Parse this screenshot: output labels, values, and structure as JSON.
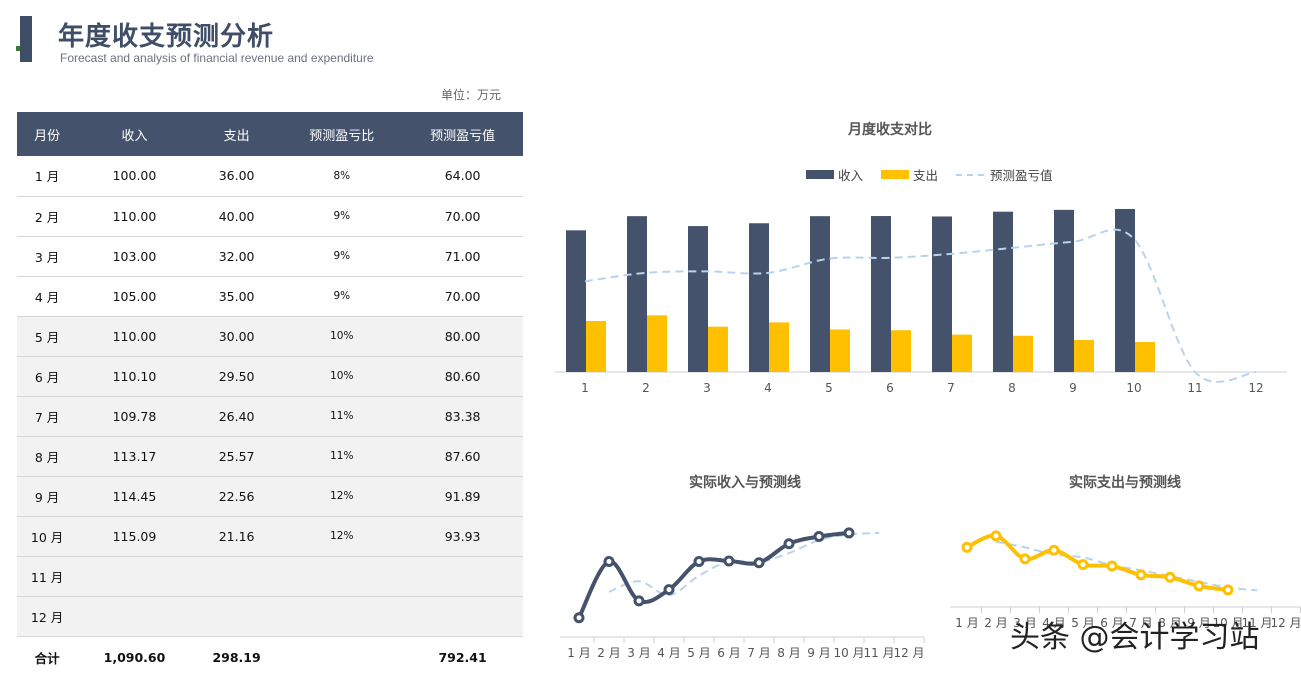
{
  "header": {
    "title": "年度收支预测分析",
    "subtitle": "Forecast and analysis of financial revenue and expenditure",
    "unit": "单位：万元"
  },
  "table": {
    "columns": [
      "月份",
      "收入",
      "支出",
      "预测盈亏比",
      "预测盈亏值"
    ],
    "rows": [
      [
        "1 月",
        "100.00",
        "36.00",
        "8%",
        "64.00"
      ],
      [
        "2 月",
        "110.00",
        "40.00",
        "9%",
        "70.00"
      ],
      [
        "3 月",
        "103.00",
        "32.00",
        "9%",
        "71.00"
      ],
      [
        "4 月",
        "105.00",
        "35.00",
        "9%",
        "70.00"
      ],
      [
        "5 月",
        "110.00",
        "30.00",
        "10%",
        "80.00"
      ],
      [
        "6 月",
        "110.10",
        "29.50",
        "10%",
        "80.60"
      ],
      [
        "7 月",
        "109.78",
        "26.40",
        "11%",
        "83.38"
      ],
      [
        "8 月",
        "113.17",
        "25.57",
        "11%",
        "87.60"
      ],
      [
        "9 月",
        "114.45",
        "22.56",
        "12%",
        "91.89"
      ],
      [
        "10 月",
        "115.09",
        "21.16",
        "12%",
        "93.93"
      ],
      [
        "11 月",
        "",
        "",
        "",
        ""
      ],
      [
        "12 月",
        "",
        "",
        "",
        ""
      ]
    ],
    "total": [
      "合计",
      "1,090.60",
      "298.19",
      "",
      "792.41"
    ]
  },
  "colors": {
    "income": "#44526b",
    "expense": "#ffc000",
    "forecast": "#b9d3ec"
  },
  "chart_data": [
    {
      "type": "bar",
      "title": "月度收支对比",
      "categories": [
        "1",
        "2",
        "3",
        "4",
        "5",
        "6",
        "7",
        "8",
        "9",
        "10",
        "11",
        "12"
      ],
      "series": [
        {
          "name": "收入",
          "values": [
            100,
            110,
            103,
            105,
            110,
            110.1,
            109.78,
            113.17,
            114.45,
            115.09,
            null,
            null
          ]
        },
        {
          "name": "支出",
          "values": [
            36,
            40,
            32,
            35,
            30,
            29.5,
            26.4,
            25.57,
            22.56,
            21.16,
            null,
            null
          ]
        },
        {
          "name": "预测盈亏值",
          "values": [
            64,
            70,
            71,
            70,
            80,
            80.6,
            83.38,
            87.6,
            91.89,
            93.93,
            0,
            0
          ]
        }
      ],
      "ylim": [
        0,
        120
      ],
      "legend": "top"
    },
    {
      "type": "line",
      "title": "实际收入与预测线",
      "categories": [
        "1 月",
        "2 月",
        "3 月",
        "4 月",
        "5 月",
        "6 月",
        "7 月",
        "8 月",
        "9 月",
        "10 月",
        "11 月",
        "12 月"
      ],
      "series": [
        {
          "values": [
            100,
            110,
            103,
            105,
            110,
            110.1,
            109.78,
            113.17,
            114.45,
            115.09,
            null,
            null
          ]
        },
        {
          "values": [
            null,
            104.6,
            106.5,
            104,
            107.5,
            110,
            109.9,
            111.5,
            113.8,
            114.8,
            115.1,
            null
          ]
        }
      ]
    },
    {
      "type": "line",
      "title": "实际支出与预测线",
      "categories": [
        "1 月",
        "2 月",
        "3 月",
        "4 月",
        "5 月",
        "6 月",
        "7 月",
        "8 月",
        "9 月",
        "10 月",
        "11 月",
        "12 月"
      ],
      "series": [
        {
          "values": [
            36,
            40,
            32,
            35,
            30,
            29.5,
            26.4,
            25.57,
            22.56,
            21.16,
            null,
            null
          ]
        },
        {
          "values": [
            null,
            38,
            36,
            33.5,
            32.5,
            29.8,
            28,
            26,
            24,
            22,
            21,
            null
          ]
        }
      ]
    }
  ],
  "watermark": "头条 @会计学习站"
}
